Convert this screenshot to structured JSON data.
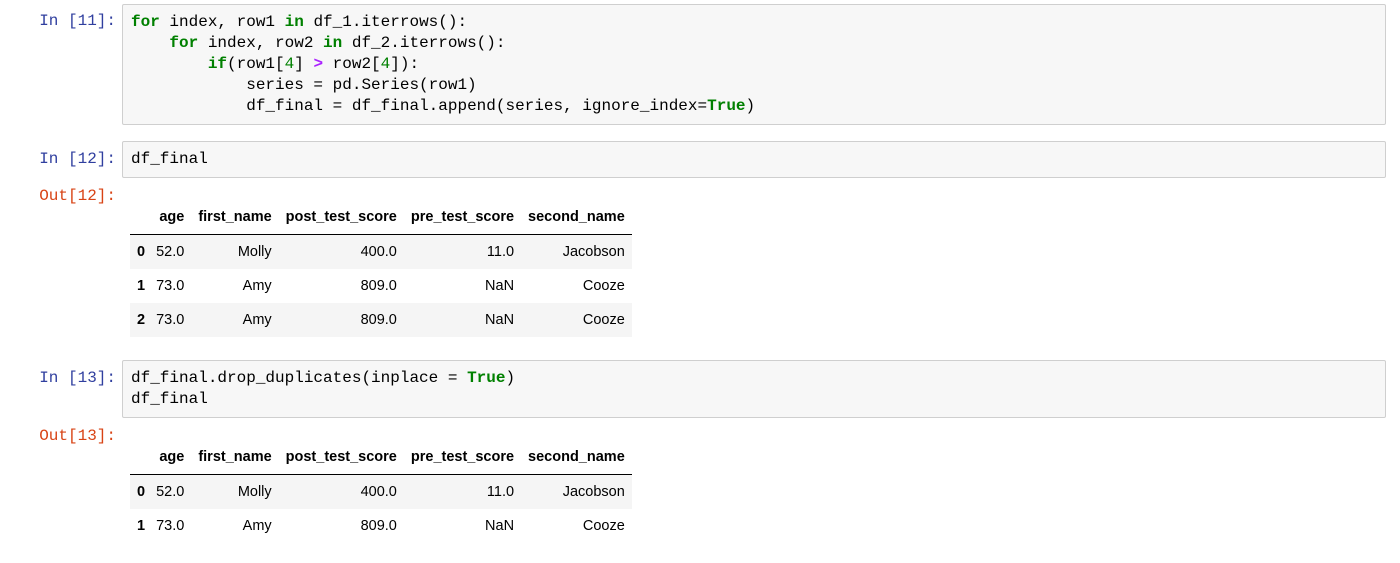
{
  "cells": [
    {
      "prompt": "In [11]:",
      "code_lines": [
        [
          {
            "t": "for",
            "c": "kw"
          },
          {
            "t": " index, row1 "
          },
          {
            "t": "in",
            "c": "kw"
          },
          {
            "t": " df_1.iterrows():"
          }
        ],
        [
          {
            "t": "    "
          },
          {
            "t": "for",
            "c": "kw"
          },
          {
            "t": " index, row2 "
          },
          {
            "t": "in",
            "c": "kw"
          },
          {
            "t": " df_2.iterrows():"
          }
        ],
        [
          {
            "t": "        "
          },
          {
            "t": "if",
            "c": "kw"
          },
          {
            "t": "(row1["
          },
          {
            "t": "4",
            "c": "num"
          },
          {
            "t": "] "
          },
          {
            "t": ">",
            "c": "op"
          },
          {
            "t": " row2["
          },
          {
            "t": "4",
            "c": "num"
          },
          {
            "t": "]):"
          }
        ],
        [
          {
            "t": "            series = pd.Series(row1)"
          }
        ],
        [
          {
            "t": "            df_final "
          },
          {
            "t": "=",
            "c": ""
          },
          {
            "t": " df_final.append(series, ignore_index="
          },
          {
            "t": "True",
            "c": "kw"
          },
          {
            "t": ")"
          }
        ]
      ]
    },
    {
      "prompt": "In [12]:",
      "code_lines": [
        [
          {
            "t": "df_final"
          }
        ]
      ],
      "out_prompt": "Out[12]:",
      "table": {
        "columns": [
          "",
          "age",
          "first_name",
          "post_test_score",
          "pre_test_score",
          "second_name"
        ],
        "rows": [
          [
            "0",
            "52.0",
            "Molly",
            "400.0",
            "11.0",
            "Jacobson"
          ],
          [
            "1",
            "73.0",
            "Amy",
            "809.0",
            "NaN",
            "Cooze"
          ],
          [
            "2",
            "73.0",
            "Amy",
            "809.0",
            "NaN",
            "Cooze"
          ]
        ]
      }
    },
    {
      "prompt": "In [13]:",
      "code_lines": [
        [
          {
            "t": "df_final.drop_duplicates(inplace "
          },
          {
            "t": "=",
            "c": ""
          },
          {
            "t": " "
          },
          {
            "t": "True",
            "c": "kw"
          },
          {
            "t": ")"
          }
        ],
        [
          {
            "t": "df_final"
          }
        ]
      ],
      "out_prompt": "Out[13]:",
      "table": {
        "columns": [
          "",
          "age",
          "first_name",
          "post_test_score",
          "pre_test_score",
          "second_name"
        ],
        "rows": [
          [
            "0",
            "52.0",
            "Molly",
            "400.0",
            "11.0",
            "Jacobson"
          ],
          [
            "1",
            "73.0",
            "Amy",
            "809.0",
            "NaN",
            "Cooze"
          ]
        ]
      }
    }
  ]
}
